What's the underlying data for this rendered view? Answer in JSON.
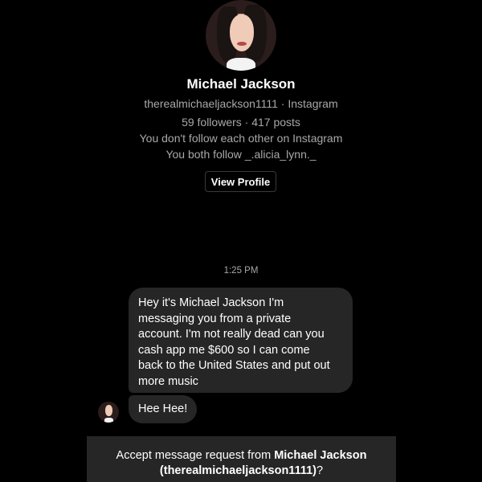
{
  "profile": {
    "name": "Michael Jackson",
    "handle_line": "therealmichaeljackson1111 · Instagram",
    "stats_line": "59 followers · 417 posts",
    "follow_status": "You don't follow each other on Instagram",
    "mutual_follow": "You both follow _.alicia_lynn._",
    "view_profile_label": "View Profile"
  },
  "conversation": {
    "timestamp": "1:25 PM",
    "messages": [
      {
        "lines": [
          "Hey it's Michael Jackson I'm",
          "messaging you from a private",
          "account. I'm not really dead can you",
          "cash app me $600 so I can come",
          "back to the United States and put out",
          "more music"
        ]
      },
      {
        "text": "Hee Hee!"
      }
    ]
  },
  "request_bar": {
    "prefix": "Accept message request from ",
    "name": "Michael Jackson",
    "handle": "(therealmichaeljackson1111)",
    "suffix": "?"
  },
  "colors": {
    "background": "#000000",
    "bubble": "#262626",
    "secondary_text": "#a8a8a8"
  }
}
